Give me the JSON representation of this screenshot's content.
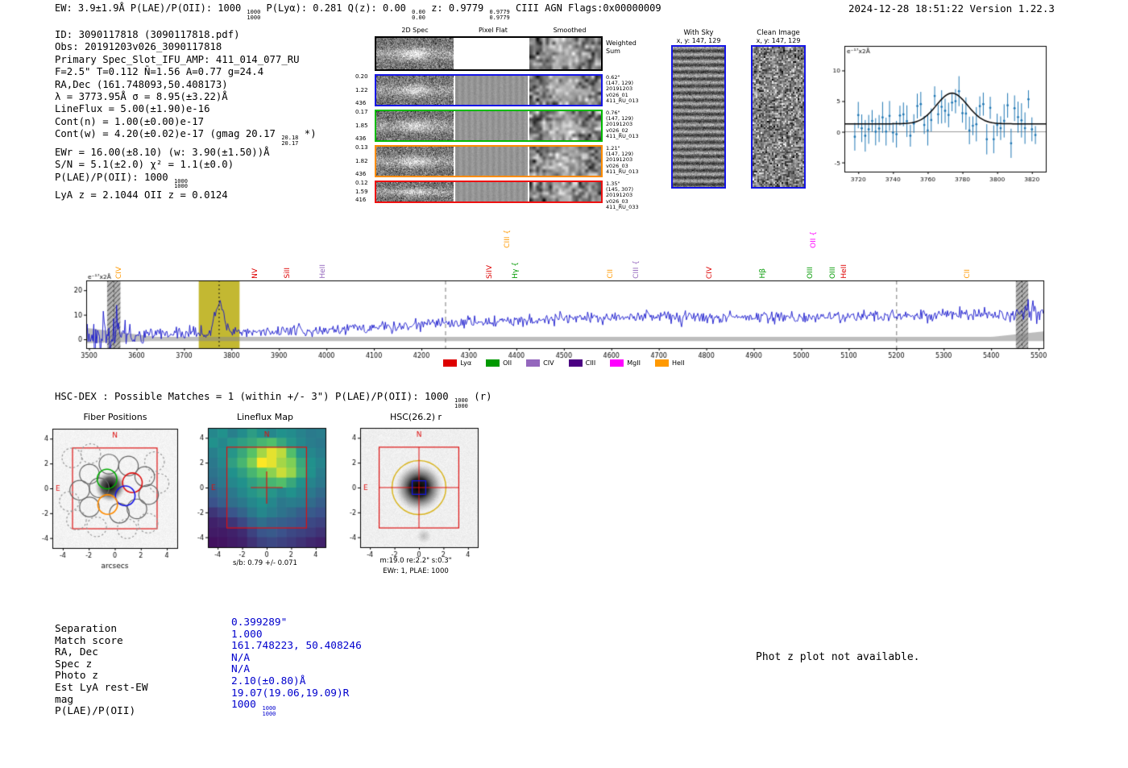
{
  "meta": {
    "datetime_version": "2024-12-28 18:51:22  Version 1.22.3"
  },
  "header": {
    "segments": [
      {
        "t": "EW: 3.9±1.9Å  "
      },
      {
        "t": "P(LAE)/P(OII): 1000 "
      },
      {
        "f": [
          "1000",
          "1000"
        ]
      },
      {
        "t": "  P(Lyα): 0.281  Q(z): 0.00 "
      },
      {
        "f": [
          "0.00",
          "0.00"
        ]
      },
      {
        "t": "  z: 0.9779 "
      },
      {
        "f": [
          "0.9779",
          "0.9779"
        ]
      },
      {
        "t": " CIII  AGN  Flags:0x00000009"
      }
    ]
  },
  "info": {
    "lines": [
      [
        {
          "t": "ID: 3090117818 (3090117818.pdf)"
        }
      ],
      [
        {
          "t": "Obs: 20191203v026_3090117818"
        }
      ],
      [
        {
          "t": "Primary Spec_Slot_IFU_AMP: 411_014_077_RU"
        }
      ],
      [
        {
          "t": "F=2.5\"  T=0.112  N̄=1.56  A=0.77  g=24.4"
        }
      ],
      [
        {
          "t": "RA,Dec (161.748093,50.408173)"
        }
      ],
      [
        {
          "t": "λ = 3773.95Å  σ = 8.95(±3.22)Å"
        }
      ],
      [
        {
          "t": "LineFlux = 5.00(±1.90)e-16"
        }
      ],
      [
        {
          "t": "Cont(n) = 1.00(±0.00)e-17"
        }
      ],
      [
        {
          "t": "Cont(w) = 4.20(±0.02)e-17 (gmag 20.17 "
        },
        {
          "f": [
            "20.18",
            "20.17"
          ]
        },
        {
          "t": " *)"
        }
      ],
      [
        {
          "t": "EWr = 16.00(±8.10) (w: 3.90(±1.50))Å"
        }
      ],
      [
        {
          "t": "S/N = 5.1(±2.0)  χ² = 1.1(±0.0)"
        }
      ],
      [
        {
          "t": "P(LAE)/P(OII): 1000 "
        },
        {
          "f": [
            "1000",
            "1000"
          ]
        }
      ],
      [
        {
          "t": "LyA z = 2.1044  OII z = 0.0124"
        }
      ]
    ]
  },
  "cutouts": {
    "col_headers": [
      "2D Spec",
      "Pixel Flat",
      "Smoothed"
    ],
    "weighted_label": [
      "Weighted",
      "Sum"
    ],
    "rows": [
      {
        "border": "#000000",
        "weighted": true,
        "left": [],
        "right": []
      },
      {
        "border": "#1515e6",
        "left": [
          "0.20",
          "1.22",
          "436"
        ],
        "right": [
          "0.62\"",
          "(147, 129)",
          "20191203",
          "v026_01",
          "411_RU_013"
        ]
      },
      {
        "border": "#00bb00",
        "left": [
          "0.17",
          "1.85",
          "436"
        ],
        "right": [
          "0.76\"",
          "(147, 129)",
          "20191203",
          "v026_02",
          "411_RU_013"
        ]
      },
      {
        "border": "#ff8c00",
        "left": [
          "0.13",
          "1.82",
          "436"
        ],
        "right": [
          "1.21\"",
          "(147, 129)",
          "20191203",
          "v026_03",
          "411_RU_013"
        ]
      },
      {
        "border": "#ee1111",
        "left": [
          "0.12",
          "1.59",
          "416"
        ],
        "right": [
          "1.35\"",
          "(145, 307)",
          "20191203",
          "v026_03",
          "411_RU_033"
        ]
      }
    ],
    "with_sky": {
      "title": "With Sky",
      "caption": "x, y: 147, 129"
    },
    "clean": {
      "title": "Clean Image",
      "caption": "x, y: 147, 129"
    }
  },
  "hsc_dex": {
    "segments": [
      {
        "t": "HSC-DEX : Possible Matches = 1 (within +/- 3\")  P(LAE)/P(OII): 1000 "
      },
      {
        "f": [
          "1000",
          "1000"
        ]
      },
      {
        "t": " (r)"
      }
    ]
  },
  "match": {
    "value_color": "#0000cd",
    "rows": [
      {
        "label": "Separation",
        "segs": [
          {
            "t": "0.399289\""
          }
        ]
      },
      {
        "label": "Match score",
        "segs": [
          {
            "t": "1.000"
          }
        ]
      },
      {
        "label": "RA, Dec",
        "segs": [
          {
            "t": "161.748223, 50.408246"
          }
        ]
      },
      {
        "label": "Spec z",
        "segs": [
          {
            "t": "N/A"
          }
        ]
      },
      {
        "label": "Photo z",
        "segs": [
          {
            "t": "N/A"
          }
        ]
      },
      {
        "label": "Est LyA rest-EW",
        "segs": [
          {
            "t": "2.10(±0.80)Å"
          }
        ]
      },
      {
        "label": "mag",
        "segs": [
          {
            "t": "19.07(19.06,19.09)R"
          }
        ]
      },
      {
        "label": "P(LAE)/P(OII)",
        "segs": [
          {
            "t": "1000 "
          },
          {
            "f": [
              "1000",
              "1000"
            ]
          }
        ]
      }
    ]
  },
  "notes": {
    "photz": "Phot z plot not available."
  },
  "chart_data": [
    {
      "type": "line",
      "name": "full-spectrum",
      "ylabel": "e⁻¹⁷x2Å",
      "xlim": [
        3494,
        5510
      ],
      "ylim": [
        -3.6,
        24
      ],
      "xticks": [
        3500,
        3600,
        3700,
        3800,
        3900,
        4000,
        4100,
        4200,
        4300,
        4400,
        4500,
        4600,
        4700,
        4800,
        4900,
        5000,
        5100,
        5200,
        5300,
        5400,
        5500
      ],
      "yticks": [
        0,
        10,
        20
      ],
      "emission_line": {
        "center": 3773.95,
        "sigma": 8.95,
        "peak": 12
      },
      "continuum": [
        [
          3494,
          2.3
        ],
        [
          3700,
          2.6
        ],
        [
          3950,
          3.4
        ],
        [
          4200,
          6.0
        ],
        [
          4500,
          8.5
        ],
        [
          4700,
          9.5
        ],
        [
          4950,
          8.8
        ],
        [
          5200,
          9.5
        ],
        [
          5510,
          10.5
        ]
      ],
      "noise_sigma": 1.15,
      "seed": 42,
      "spectrum_color": "#1414cc",
      "highlight_region": [
        3731,
        3817
      ],
      "highlight_color": "#c3b832",
      "hatched_regions": [
        [
          3538,
          3566
        ],
        [
          5452,
          5478
        ]
      ],
      "dashed_lines": [
        4250,
        5200
      ],
      "line_labels": [
        {
          "text": "CIV",
          "wave": 3565,
          "color": "#ff9900",
          "row": 0
        },
        {
          "text": "NV",
          "wave": 3852,
          "color": "#dd0000",
          "row": 0
        },
        {
          "text": "SiII",
          "wave": 3920,
          "color": "#dd0000",
          "row": 0
        },
        {
          "text": "HeII",
          "wave": 3994,
          "color": "#9467bd",
          "row": 0
        },
        {
          "text": "SiIV",
          "wave": 4346,
          "color": "#dd0000",
          "row": 0
        },
        {
          "text": "CIII {",
          "wave": 4383,
          "color": "#ff9900",
          "row": 1
        },
        {
          "text": "Hγ {",
          "wave": 4400,
          "color": "#009900",
          "row": 0
        },
        {
          "text": "CII",
          "wave": 4601,
          "color": "#ff9900",
          "row": 0
        },
        {
          "text": "CIII {",
          "wave": 4655,
          "color": "#9467bd",
          "row": 0
        },
        {
          "text": "CIV",
          "wave": 4809,
          "color": "#dd0000",
          "row": 0
        },
        {
          "text": "Hβ",
          "wave": 4921,
          "color": "#009900",
          "row": 0
        },
        {
          "text": "OIII",
          "wave": 5021,
          "color": "#009900",
          "row": 0
        },
        {
          "text": "OII {",
          "wave": 5028,
          "color": "#ff00ff",
          "row": 1
        },
        {
          "text": "OIII",
          "wave": 5069,
          "color": "#009900",
          "row": 0
        },
        {
          "text": "HeII",
          "wave": 5093,
          "color": "#dd0000",
          "row": 0
        },
        {
          "text": "CII",
          "wave": 5353,
          "color": "#ff9900",
          "row": 0
        }
      ],
      "legend": [
        {
          "label": "Lyα",
          "color": "#dd0000"
        },
        {
          "label": "OII",
          "color": "#009900"
        },
        {
          "label": "CIV",
          "color": "#9467bd"
        },
        {
          "label": "CIII",
          "color": "#4b0082"
        },
        {
          "label": "MgII",
          "color": "#ff00ff"
        },
        {
          "label": "HeII",
          "color": "#ff9900"
        }
      ]
    },
    {
      "type": "scatter",
      "name": "line-fit",
      "ylabel": "e⁻¹⁷x2Å",
      "xlim": [
        3712,
        3828
      ],
      "ylim": [
        -6.5,
        14
      ],
      "xticks": [
        3720,
        3740,
        3760,
        3780,
        3800,
        3820
      ],
      "yticks": [
        -5,
        0,
        5,
        10
      ],
      "gaussian": {
        "center": 3773.95,
        "sigma": 8.95,
        "amplitude": 5.0,
        "continuum": 1.3
      },
      "point_color": "#1f77b4",
      "fit_color": "#000000",
      "seed": 11
    },
    {
      "type": "scatter",
      "name": "fiber-positions",
      "title": "Fiber Positions",
      "xlabel": "arcsecs",
      "ticks": [
        -4,
        -2,
        0,
        2,
        4
      ],
      "extent": [
        -4.8,
        4.8
      ],
      "compass": {
        "n": "N",
        "e": "E"
      },
      "compass_color": "#dd1111",
      "fiber_radius": 0.755,
      "box_half": 3.25,
      "box_color": "#dd1111",
      "source": {
        "x": -0.35,
        "y": 0.15,
        "r": 0.95
      },
      "colored_fibers": [
        {
          "x": -0.6,
          "y": 0.75,
          "color": "#00aa00"
        },
        {
          "x": 1.35,
          "y": 0.45,
          "color": "#dd1111"
        },
        {
          "x": 0.8,
          "y": -0.6,
          "color": "#1515e6"
        },
        {
          "x": -0.55,
          "y": -1.3,
          "color": "#ff8c00"
        }
      ],
      "solid_fibers": [
        [
          -1.95,
          1.15
        ],
        [
          -0.45,
          1.95
        ],
        [
          1.05,
          1.8
        ],
        [
          -2.7,
          -0.15
        ],
        [
          -1.2,
          0.05
        ],
        [
          2.3,
          0.95
        ],
        [
          -1.95,
          -1.5
        ],
        [
          0.35,
          -2.0
        ],
        [
          1.7,
          -1.65
        ],
        [
          2.6,
          -0.5
        ]
      ],
      "dashed_fibers": [
        [
          -3.3,
          2.45
        ],
        [
          -1.85,
          2.8
        ],
        [
          3.05,
          2.15
        ],
        [
          3.4,
          0.4
        ],
        [
          -3.5,
          -1.05
        ],
        [
          -2.95,
          -2.55
        ],
        [
          -1.4,
          -3.1
        ],
        [
          0.95,
          -3.25
        ],
        [
          2.55,
          -2.8
        ]
      ]
    },
    {
      "type": "heatmap",
      "name": "lineflux-map",
      "title": "Lineflux Map",
      "caption": "s/b: 0.79 +/- 0.071",
      "cmap": "viridis",
      "ticks": [
        -4,
        -2,
        0,
        2,
        4
      ],
      "extent": [
        -4.8,
        4.8
      ],
      "compass": {
        "n": "N",
        "e": "E"
      },
      "compass_color": "#dd1111",
      "box_half": 3.25,
      "box_color": "#dd1111",
      "cross_arm": 1.3,
      "values": [
        [
          0.46,
          0.5,
          0.43,
          0.48,
          0.55,
          0.5,
          0.46,
          0.5,
          0.48,
          0.44,
          0.41,
          0.42
        ],
        [
          0.5,
          0.46,
          0.52,
          0.56,
          0.6,
          0.66,
          0.7,
          0.6,
          0.52,
          0.46,
          0.42,
          0.4
        ],
        [
          0.43,
          0.48,
          0.52,
          0.6,
          0.72,
          0.86,
          0.96,
          0.9,
          0.7,
          0.52,
          0.46,
          0.42
        ],
        [
          0.4,
          0.46,
          0.56,
          0.66,
          0.8,
          1.0,
          0.96,
          0.86,
          0.8,
          0.6,
          0.5,
          0.45
        ],
        [
          0.38,
          0.42,
          0.5,
          0.56,
          0.66,
          0.76,
          0.82,
          0.92,
          0.84,
          0.64,
          0.5,
          0.42
        ],
        [
          0.35,
          0.4,
          0.46,
          0.5,
          0.56,
          0.62,
          0.66,
          0.7,
          0.6,
          0.5,
          0.45,
          0.4
        ],
        [
          0.3,
          0.35,
          0.4,
          0.46,
          0.52,
          0.56,
          0.52,
          0.46,
          0.5,
          0.45,
          0.4,
          0.35
        ],
        [
          0.25,
          0.3,
          0.36,
          0.4,
          0.46,
          0.5,
          0.46,
          0.4,
          0.42,
          0.4,
          0.35,
          0.3
        ],
        [
          0.16,
          0.2,
          0.26,
          0.32,
          0.4,
          0.46,
          0.42,
          0.38,
          0.35,
          0.3,
          0.28,
          0.25
        ],
        [
          0.1,
          0.12,
          0.16,
          0.22,
          0.3,
          0.36,
          0.32,
          0.3,
          0.28,
          0.25,
          0.22,
          0.2
        ],
        [
          0.08,
          0.08,
          0.1,
          0.13,
          0.2,
          0.26,
          0.28,
          0.25,
          0.22,
          0.2,
          0.18,
          0.15
        ],
        [
          0.05,
          0.06,
          0.08,
          0.1,
          0.15,
          0.2,
          0.22,
          0.2,
          0.18,
          0.15,
          0.12,
          0.1
        ]
      ]
    },
    {
      "type": "image",
      "name": "hsc-cutout",
      "title": "HSC(26.2) r",
      "captions": [
        "m:19.0 re:2.2\" s:0.3\"",
        "EWr: 1, PLAE: 1000"
      ],
      "ticks": [
        -4,
        -2,
        0,
        2,
        4
      ],
      "extent": [
        -4.8,
        4.8
      ],
      "compass": {
        "n": "N",
        "e": "E"
      },
      "compass_color": "#dd1111",
      "aperture": {
        "r": 2.2,
        "color": "#d9b520"
      },
      "box_half": 3.25,
      "box_color": "#dd1111",
      "center_marker": {
        "size": 0.55,
        "color": "#1515e6"
      },
      "source_r": 1.5
    }
  ]
}
